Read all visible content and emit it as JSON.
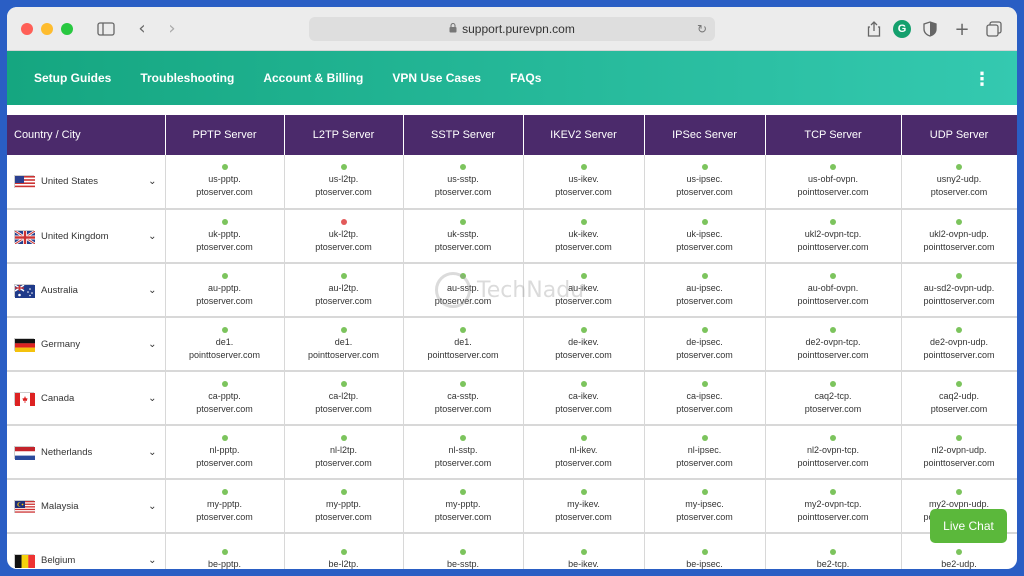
{
  "colors": {
    "nav_gradient_start": "#15a680",
    "nav_gradient_end": "#34c9b0",
    "header_bg": "#4b2a6b",
    "live_chat_bg": "#5bb83b",
    "status_ok": "#7cc45d",
    "status_down": "#e25a5a",
    "close": "#ff5f57",
    "minimize": "#febc2e",
    "zoom": "#28c840",
    "grammarly": "#14a06d"
  },
  "browser": {
    "url": "support.purevpn.com",
    "icons": [
      "sidebar-icon",
      "back-icon",
      "forward-icon",
      "reload-icon",
      "share-icon",
      "grammarly-icon",
      "privacy-shield-icon",
      "new-tab-icon",
      "tab-overview-icon"
    ],
    "grammarly_letter": "G"
  },
  "nav": {
    "links": [
      "Setup Guides",
      "Troubleshooting",
      "Account & Billing",
      "VPN Use Cases",
      "FAQs"
    ]
  },
  "table": {
    "headers": [
      "Country / City",
      "PPTP Server",
      "L2TP Server",
      "SSTP Server",
      "IKEV2 Server",
      "IPSec Server",
      "TCP Server",
      "UDP Server"
    ],
    "rows": [
      {
        "country": "United States",
        "flag": "us-flag",
        "cells": [
          {
            "l1": "us-pptp.",
            "l2": "ptoserver.com",
            "status": "ok"
          },
          {
            "l1": "us-l2tp.",
            "l2": "ptoserver.com",
            "status": "ok"
          },
          {
            "l1": "us-sstp.",
            "l2": "ptoserver.com",
            "status": "ok"
          },
          {
            "l1": "us-ikev.",
            "l2": "ptoserver.com",
            "status": "ok"
          },
          {
            "l1": "us-ipsec.",
            "l2": "ptoserver.com",
            "status": "ok"
          },
          {
            "l1": "us-obf-ovpn.",
            "l2": "pointtoserver.com",
            "status": "ok"
          },
          {
            "l1": "usny2-udp.",
            "l2": "ptoserver.com",
            "status": "ok"
          }
        ]
      },
      {
        "country": "United Kingdom",
        "flag": "uk-flag",
        "cells": [
          {
            "l1": "uk-pptp.",
            "l2": "ptoserver.com",
            "status": "ok"
          },
          {
            "l1": "uk-l2tp.",
            "l2": "ptoserver.com",
            "status": "down"
          },
          {
            "l1": "uk-sstp.",
            "l2": "ptoserver.com",
            "status": "ok"
          },
          {
            "l1": "uk-ikev.",
            "l2": "ptoserver.com",
            "status": "ok"
          },
          {
            "l1": "uk-ipsec.",
            "l2": "ptoserver.com",
            "status": "ok"
          },
          {
            "l1": "ukl2-ovpn-tcp.",
            "l2": "pointtoserver.com",
            "status": "ok"
          },
          {
            "l1": "ukl2-ovpn-udp.",
            "l2": "pointtoserver.com",
            "status": "ok"
          }
        ]
      },
      {
        "country": "Australia",
        "flag": "au-flag",
        "cells": [
          {
            "l1": "au-pptp.",
            "l2": "ptoserver.com",
            "status": "ok"
          },
          {
            "l1": "au-l2tp.",
            "l2": "ptoserver.com",
            "status": "ok"
          },
          {
            "l1": "au-sstp.",
            "l2": "ptoserver.com",
            "status": "ok"
          },
          {
            "l1": "au-ikev.",
            "l2": "ptoserver.com",
            "status": "ok"
          },
          {
            "l1": "au-ipsec.",
            "l2": "ptoserver.com",
            "status": "ok"
          },
          {
            "l1": "au-obf-ovpn.",
            "l2": "pointtoserver.com",
            "status": "ok"
          },
          {
            "l1": "au-sd2-ovpn-udp.",
            "l2": "pointtoserver.com",
            "status": "ok"
          }
        ]
      },
      {
        "country": "Germany",
        "flag": "de-flag",
        "cells": [
          {
            "l1": "de1.",
            "l2": "pointtoserver.com",
            "status": "ok"
          },
          {
            "l1": "de1.",
            "l2": "pointtoserver.com",
            "status": "ok"
          },
          {
            "l1": "de1.",
            "l2": "pointtoserver.com",
            "status": "ok"
          },
          {
            "l1": "de-ikev.",
            "l2": "ptoserver.com",
            "status": "ok"
          },
          {
            "l1": "de-ipsec.",
            "l2": "ptoserver.com",
            "status": "ok"
          },
          {
            "l1": "de2-ovpn-tcp.",
            "l2": "pointtoserver.com",
            "status": "ok"
          },
          {
            "l1": "de2-ovpn-udp.",
            "l2": "pointtoserver.com",
            "status": "ok"
          }
        ]
      },
      {
        "country": "Canada",
        "flag": "ca-flag",
        "cells": [
          {
            "l1": "ca-pptp.",
            "l2": "ptoserver.com",
            "status": "ok"
          },
          {
            "l1": "ca-l2tp.",
            "l2": "ptoserver.com",
            "status": "ok"
          },
          {
            "l1": "ca-sstp.",
            "l2": "ptoserver.com",
            "status": "ok"
          },
          {
            "l1": "ca-ikev.",
            "l2": "ptoserver.com",
            "status": "ok"
          },
          {
            "l1": "ca-ipsec.",
            "l2": "ptoserver.com",
            "status": "ok"
          },
          {
            "l1": "caq2-tcp.",
            "l2": "ptoserver.com",
            "status": "ok"
          },
          {
            "l1": "caq2-udp.",
            "l2": "ptoserver.com",
            "status": "ok"
          }
        ]
      },
      {
        "country": "Netherlands",
        "flag": "nl-flag",
        "cells": [
          {
            "l1": "nl-pptp.",
            "l2": "ptoserver.com",
            "status": "ok"
          },
          {
            "l1": "nl-l2tp.",
            "l2": "ptoserver.com",
            "status": "ok"
          },
          {
            "l1": "nl-sstp.",
            "l2": "ptoserver.com",
            "status": "ok"
          },
          {
            "l1": "nl-ikev.",
            "l2": "ptoserver.com",
            "status": "ok"
          },
          {
            "l1": "nl-ipsec.",
            "l2": "ptoserver.com",
            "status": "ok"
          },
          {
            "l1": "nl2-ovpn-tcp.",
            "l2": "pointtoserver.com",
            "status": "ok"
          },
          {
            "l1": "nl2-ovpn-udp.",
            "l2": "pointtoserver.com",
            "status": "ok"
          }
        ]
      },
      {
        "country": "Malaysia",
        "flag": "my-flag",
        "cells": [
          {
            "l1": "my-pptp.",
            "l2": "ptoserver.com",
            "status": "ok"
          },
          {
            "l1": "my-pptp.",
            "l2": "ptoserver.com",
            "status": "ok"
          },
          {
            "l1": "my-pptp.",
            "l2": "ptoserver.com",
            "status": "ok"
          },
          {
            "l1": "my-ikev.",
            "l2": "ptoserver.com",
            "status": "ok"
          },
          {
            "l1": "my-ipsec.",
            "l2": "ptoserver.com",
            "status": "ok"
          },
          {
            "l1": "my2-ovpn-tcp.",
            "l2": "pointtoserver.com",
            "status": "ok"
          },
          {
            "l1": "my2-ovpn-udp.",
            "l2": "pointtoserver.com",
            "status": "ok"
          }
        ]
      },
      {
        "country": "Belgium",
        "flag": "be-flag",
        "cells": [
          {
            "l1": "be-pptp.",
            "l2": "",
            "status": "ok"
          },
          {
            "l1": "be-l2tp.",
            "l2": "",
            "status": "ok"
          },
          {
            "l1": "be-sstp.",
            "l2": "",
            "status": "ok"
          },
          {
            "l1": "be-ikev.",
            "l2": "",
            "status": "ok"
          },
          {
            "l1": "be-ipsec.",
            "l2": "",
            "status": "ok"
          },
          {
            "l1": "be2-tcp.",
            "l2": "",
            "status": "ok"
          },
          {
            "l1": "be2-udp.",
            "l2": "",
            "status": "ok"
          }
        ]
      }
    ]
  },
  "live_chat": {
    "label": "Live Chat"
  },
  "watermark": {
    "text": "TechNadu"
  }
}
